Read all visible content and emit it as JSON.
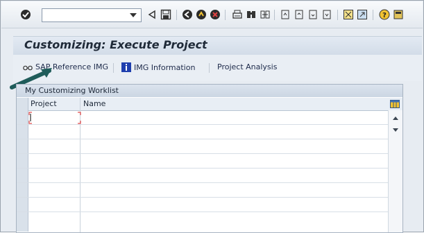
{
  "toolbar": {
    "command_value": "",
    "icons": [
      "enter-icon",
      "dropdown-icon",
      "back-triangle-icon",
      "save-icon",
      "back-icon",
      "exit-icon",
      "cancel-icon",
      "print-icon",
      "find-icon",
      "find-next-icon",
      "first-page-icon",
      "previous-page-icon",
      "next-page-icon",
      "last-page-icon",
      "create-session-icon",
      "shortcut-icon",
      "help-icon",
      "layout-icon"
    ]
  },
  "title": "Customizing: Execute Project",
  "app_toolbar": {
    "sap_ref": "SAP Reference IMG",
    "img_info": "IMG Information",
    "project_analysis": "Project Analysis"
  },
  "worklist": {
    "title": "My Customizing Worklist",
    "columns": [
      "Project",
      "Name"
    ],
    "rows": [
      "",
      "",
      "",
      "",
      "",
      "",
      "",
      ""
    ]
  },
  "colors": {
    "accent": "#1f5c5a",
    "title_text": "#1f2a38",
    "link_text": "#1d2a4a"
  }
}
